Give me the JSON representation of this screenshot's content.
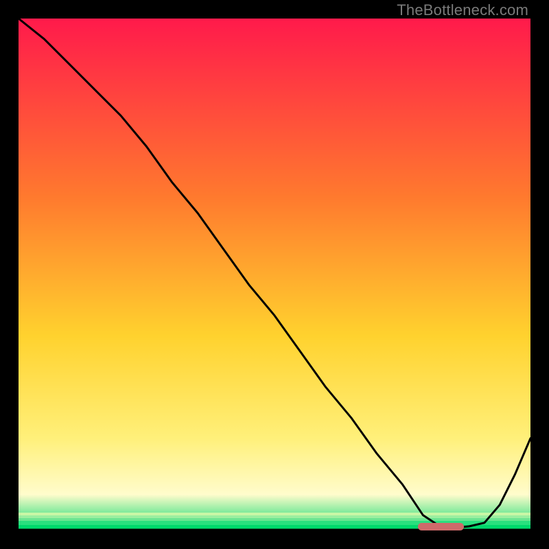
{
  "watermark": "TheBottleneck.com",
  "colors": {
    "gradient_top": "#ff1a4b",
    "gradient_mid1": "#ff7a2e",
    "gradient_mid2": "#ffd22e",
    "gradient_mid3": "#fff07a",
    "gradient_mid4": "#fffccc",
    "gradient_bottom": "#00d86b",
    "curve": "#000000",
    "marker": "#cf6a6a",
    "axis": "#000000"
  },
  "chart_data": {
    "type": "line",
    "title": "",
    "xlabel": "",
    "ylabel": "",
    "xlim": [
      0,
      100
    ],
    "ylim": [
      0,
      100
    ],
    "x": [
      0,
      5,
      10,
      15,
      20,
      25,
      30,
      35,
      40,
      45,
      50,
      55,
      60,
      65,
      70,
      75,
      79,
      82,
      85,
      88,
      91,
      94,
      97,
      100
    ],
    "values": [
      100,
      96,
      91,
      86,
      81,
      75,
      68,
      62,
      55,
      48,
      42,
      35,
      28,
      22,
      15,
      9,
      3,
      1,
      0.5,
      0.8,
      1.5,
      5,
      11,
      18
    ],
    "marker_range_x": [
      78,
      87
    ],
    "note": "Values estimated from pixel positions; y=0 is bottom (green), y=100 is top (red)."
  }
}
